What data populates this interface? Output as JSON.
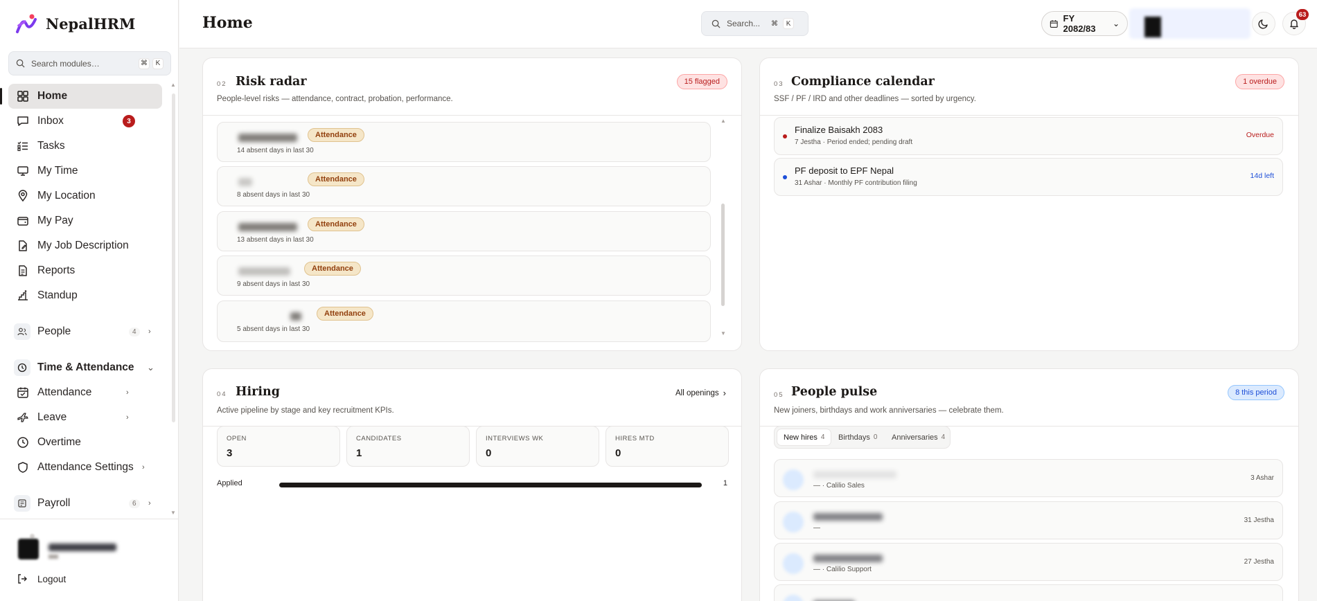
{
  "brand": {
    "name": "NepalHRM"
  },
  "sidebar": {
    "search_placeholder": "Search modules…",
    "kbd": [
      "⌘",
      "K"
    ],
    "items": [
      {
        "label": "Home",
        "icon": "grid-icon",
        "active": true
      },
      {
        "label": "Inbox",
        "icon": "inbox-icon",
        "badge": "3"
      },
      {
        "label": "Tasks",
        "icon": "list-check-icon"
      },
      {
        "label": "My Time",
        "icon": "monitor-icon"
      },
      {
        "label": "My Location",
        "icon": "map-pin-icon"
      },
      {
        "label": "My Pay",
        "icon": "wallet-icon"
      },
      {
        "label": "My Job Description",
        "icon": "file-edit-icon"
      },
      {
        "label": "Reports",
        "icon": "report-icon"
      },
      {
        "label": "Standup",
        "icon": "standup-icon"
      }
    ],
    "groups": {
      "people": {
        "label": "People",
        "count": "4"
      },
      "time_attendance": {
        "label": "Time & Attendance"
      },
      "payroll": {
        "label": "Payroll",
        "count": "6"
      }
    },
    "sub_items": [
      {
        "label": "Attendance",
        "has_chevron": true
      },
      {
        "label": "Leave",
        "has_chevron": true
      },
      {
        "label": "Overtime",
        "has_chevron": false
      },
      {
        "label": "Attendance Settings",
        "has_chevron": true
      }
    ],
    "logout_label": "Logout"
  },
  "header": {
    "title": "Home",
    "search_placeholder": "Search...",
    "kbd": [
      "⌘",
      "K"
    ],
    "fy_label": "FY 2082/83",
    "notification_count": "63"
  },
  "risk_radar": {
    "num": "02",
    "title": "Risk radar",
    "subtitle": "People-level risks — attendance, contract, probation, performance.",
    "flag_badge": "15 flagged",
    "rows": [
      {
        "tag": "Attendance",
        "detail": "14 absent days in last 30"
      },
      {
        "tag": "Attendance",
        "detail": "8 absent days in last 30"
      },
      {
        "tag": "Attendance",
        "detail": "13 absent days in last 30"
      },
      {
        "tag": "Attendance",
        "detail": "9 absent days in last 30"
      },
      {
        "tag": "Attendance",
        "detail": "5 absent days in last 30"
      }
    ]
  },
  "compliance": {
    "num": "03",
    "title": "Compliance calendar",
    "subtitle": "SSF / PF / IRD and other deadlines — sorted by urgency.",
    "overdue_badge": "1 overdue",
    "rows": [
      {
        "title": "Finalize Baisakh 2083",
        "meta": "7 Jestha · Period ended; pending draft",
        "status": "Overdue",
        "color": "#b91c1c"
      },
      {
        "title": "PF deposit to EPF Nepal",
        "meta": "31 Ashar · Monthly PF contribution filing",
        "status": "14d left",
        "color": "#1d4ed8"
      }
    ]
  },
  "hiring": {
    "num": "04",
    "title": "Hiring",
    "subtitle": "Active pipeline by stage and key recruitment KPIs.",
    "all_openings": "All openings",
    "kpis": [
      {
        "label": "OPEN",
        "value": "3"
      },
      {
        "label": "CANDIDATES",
        "value": "1"
      },
      {
        "label": "INTERVIEWS WK",
        "value": "0"
      },
      {
        "label": "HIRES MTD",
        "value": "0"
      }
    ],
    "pipeline": [
      {
        "stage": "Applied",
        "count": "1",
        "fraction": 1.0
      }
    ]
  },
  "people_pulse": {
    "num": "05",
    "title": "People pulse",
    "subtitle": "New joiners, birthdays and work anniversaries — celebrate them.",
    "period_badge": "8 this period",
    "tabs": [
      {
        "label": "New hires",
        "count": "4",
        "active": true
      },
      {
        "label": "Birthdays",
        "count": "0"
      },
      {
        "label": "Anniversaries",
        "count": "4"
      }
    ],
    "rows": [
      {
        "meta": "— · Calilio Sales",
        "date": "3 Ashar"
      },
      {
        "meta": "—",
        "date": "31 Jestha"
      },
      {
        "meta": "— · Calilio Support",
        "date": "27 Jestha"
      },
      {
        "meta": "",
        "date": ""
      }
    ]
  }
}
